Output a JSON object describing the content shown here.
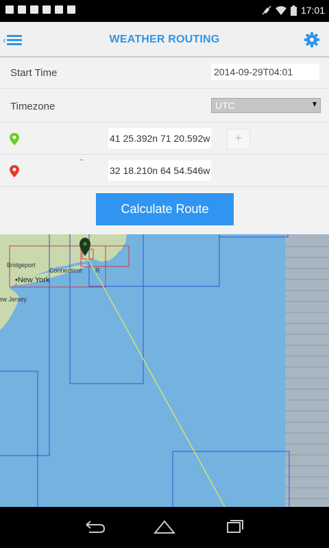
{
  "status_bar": {
    "time": "17:01"
  },
  "action_bar": {
    "title": "WEATHER ROUTING",
    "menu_icon": "hamburger-menu-icon",
    "settings_icon": "gear-icon"
  },
  "form": {
    "start_time": {
      "label": "Start Time",
      "value": "2014-09-29T04:01"
    },
    "timezone": {
      "label": "Timezone",
      "value": "UTC"
    },
    "waypoints": [
      {
        "pin_color": "#6bcf1f",
        "coords": "41 25.392n 71 20.592w",
        "action": "+"
      },
      {
        "pin_color": "#e53b2f",
        "coords": "32 18.210n 64 54.546w",
        "action": "-"
      }
    ],
    "calculate_label": "Calculate Route"
  },
  "map": {
    "labels": {
      "state": "Connecticut",
      "abbr": "R",
      "bridgeport": "Bridgeport",
      "new_york": "New York",
      "new_jersey": "New Jersey"
    },
    "colors": {
      "ocean": "#74b2e0",
      "land": "#c9d9ad",
      "route": "#e3ef56",
      "grid_blue": "#2f54d8",
      "grid_red": "#d03a48"
    }
  },
  "nav_bar": {
    "back_icon": "back-icon",
    "home_icon": "home-icon",
    "recents_icon": "recents-icon"
  }
}
